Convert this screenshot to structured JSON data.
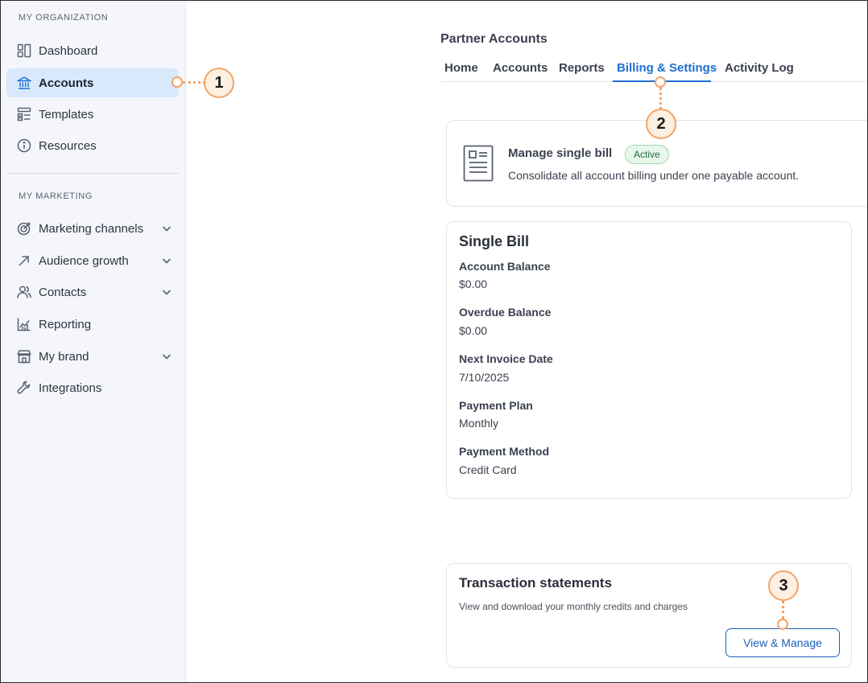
{
  "sidebar": {
    "section_org": "MY ORGANIZATION",
    "section_marketing": "MY MARKETING",
    "items": [
      {
        "label": "Dashboard",
        "icon": "dashboard-icon"
      },
      {
        "label": "Accounts",
        "icon": "bank-icon",
        "active": true
      },
      {
        "label": "Templates",
        "icon": "templates-icon"
      },
      {
        "label": "Resources",
        "icon": "info-icon"
      },
      {
        "label": "Marketing channels",
        "icon": "target-icon",
        "expandable": true
      },
      {
        "label": "Audience growth",
        "icon": "arrow-up-right-icon",
        "expandable": true
      },
      {
        "label": "Contacts",
        "icon": "people-icon",
        "expandable": true
      },
      {
        "label": "Reporting",
        "icon": "chart-icon"
      },
      {
        "label": "My brand",
        "icon": "storefront-icon",
        "expandable": true
      },
      {
        "label": "Integrations",
        "icon": "wrench-icon"
      }
    ]
  },
  "header": {
    "title": "Partner Accounts",
    "tabs": [
      "Home",
      "Accounts",
      "Reports",
      "Billing & Settings",
      "Activity Log"
    ],
    "active_tab": "Billing & Settings"
  },
  "manage": {
    "title": "Manage single bill",
    "badge": "Active",
    "description": "Consolidate all account billing under one payable account."
  },
  "single_bill": {
    "title": "Single Bill",
    "fields": [
      {
        "label": "Account Balance",
        "value": "$0.00"
      },
      {
        "label": "Overdue Balance",
        "value": "$0.00"
      },
      {
        "label": "Next Invoice Date",
        "value": "7/10/2025"
      },
      {
        "label": "Payment Plan",
        "value": "Monthly"
      },
      {
        "label": "Payment Method",
        "value": "Credit Card"
      }
    ]
  },
  "transactions": {
    "title": "Transaction statements",
    "description": "View and download your monthly credits and charges",
    "button_label": "View & Manage"
  },
  "callouts": [
    "1",
    "2",
    "3"
  ],
  "colors": {
    "accent": "#1f6fd1",
    "active_nav_bg": "#d7e9fb",
    "callout_orange": "#f3a467",
    "badge_green": "#1f6d37"
  }
}
